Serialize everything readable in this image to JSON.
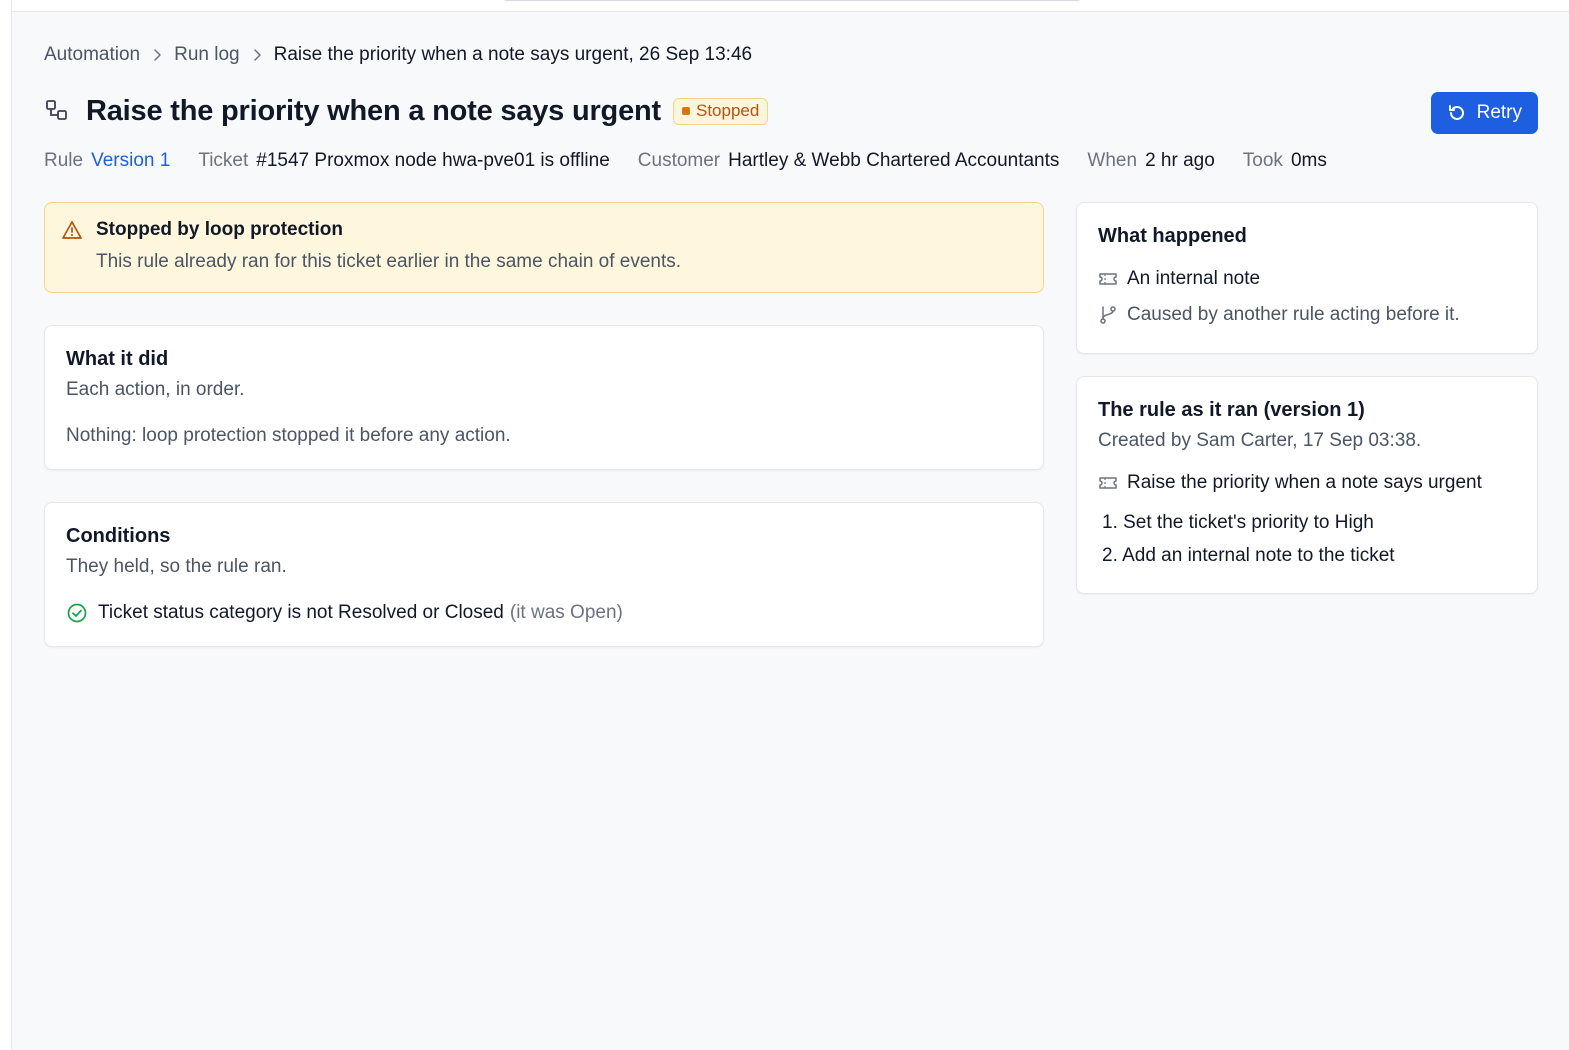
{
  "breadcrumb": {
    "items": [
      "Automation",
      "Run log"
    ],
    "current": "Raise the priority when a note says urgent, 26 Sep 13:46"
  },
  "header": {
    "title": "Raise the priority when a note says urgent",
    "status": "Stopped",
    "retry_label": "Retry",
    "title_icon": "automation-icon"
  },
  "meta": {
    "rule_label": "Rule",
    "rule_value": "Version 1",
    "ticket_label": "Ticket",
    "ticket_value": "#1547 Proxmox node hwa-pve01 is offline",
    "customer_label": "Customer",
    "customer_value": "Hartley & Webb Chartered Accountants",
    "when_label": "When",
    "when_value": "2 hr ago",
    "took_label": "Took",
    "took_value": "0ms"
  },
  "alert": {
    "title": "Stopped by loop protection",
    "text": "This rule already ran for this ticket earlier in the same chain of events."
  },
  "actions_card": {
    "title": "What it did",
    "subtitle": "Each action, in order.",
    "body": "Nothing: loop protection stopped it before any action."
  },
  "conditions_card": {
    "title": "Conditions",
    "subtitle": "They held, so the rule ran.",
    "condition_text": "Ticket status category is not Resolved or Closed",
    "condition_note": "(it was Open)"
  },
  "happened_card": {
    "title": "What happened",
    "trigger": "An internal note",
    "cause": "Caused by another rule acting before it."
  },
  "rule_card": {
    "title": "The rule as it ran (version 1)",
    "subtitle": "Created by Sam Carter, 17 Sep 03:38.",
    "rule_name": "Raise the priority when a note says urgent",
    "steps": [
      "1. Set the ticket's priority to High",
      "2. Add an internal note to the ticket"
    ]
  },
  "colors": {
    "accent": "#1d5fe0",
    "warning_bg": "#fef7dd",
    "warning_border": "#f3d58a",
    "warning_text": "#b45309",
    "success": "#16a34a"
  }
}
